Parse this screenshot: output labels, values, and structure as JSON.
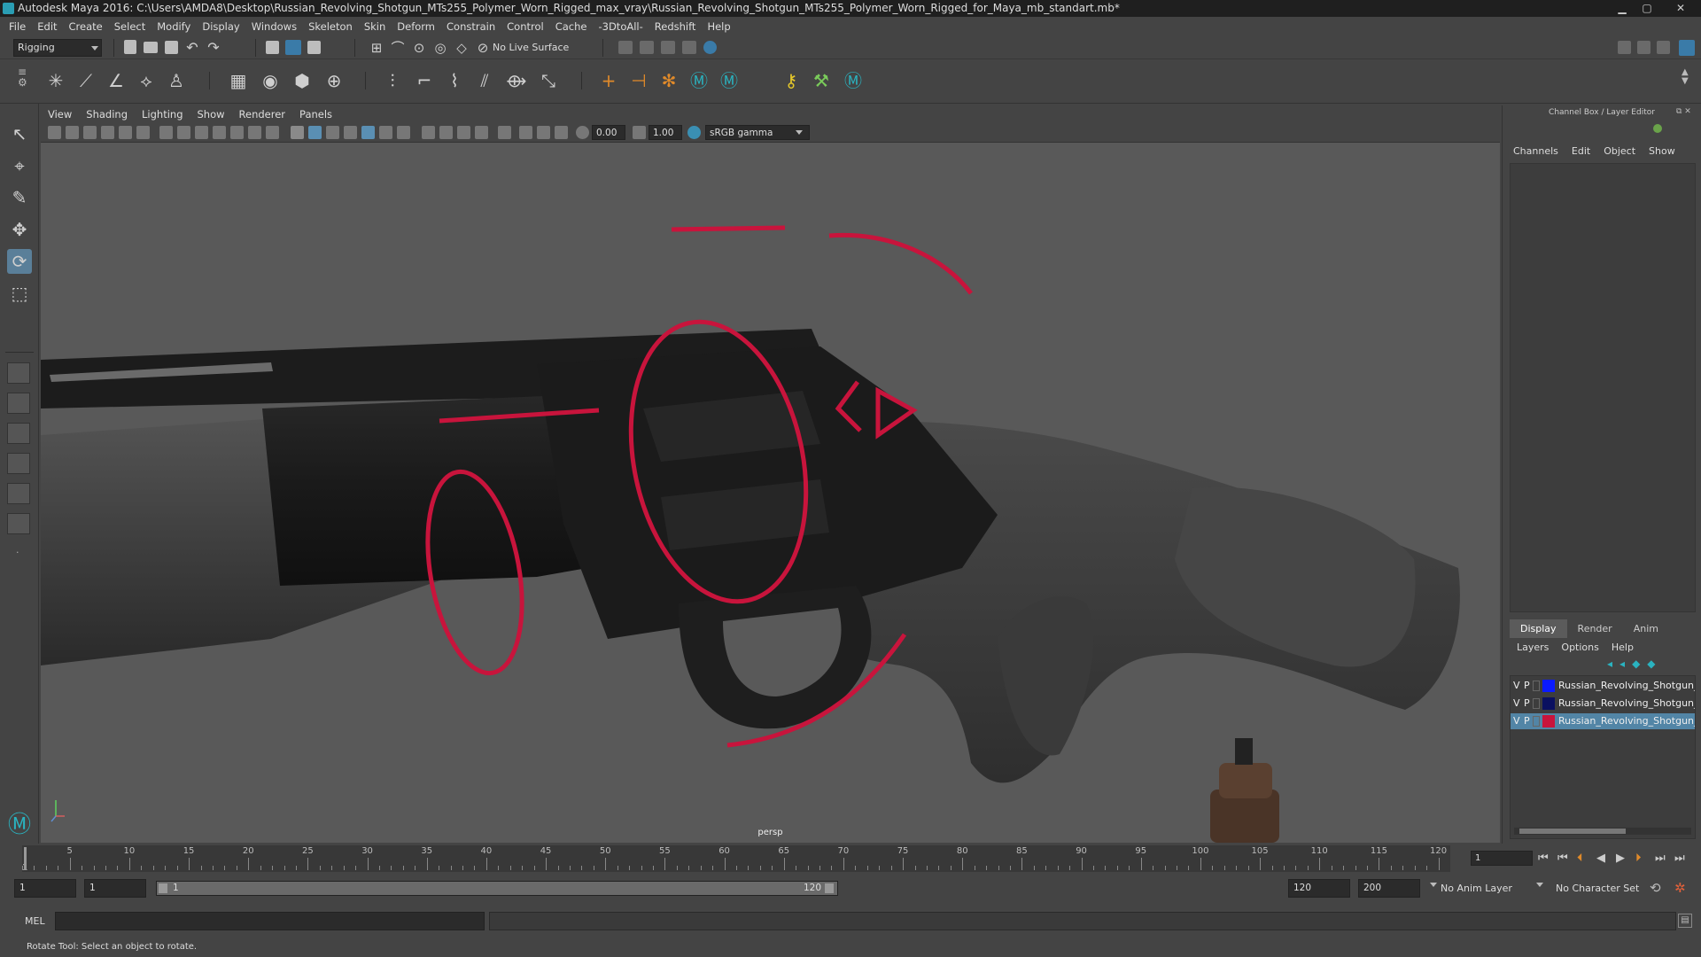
{
  "window": {
    "title": "Autodesk Maya 2016: C:\\Users\\AMDA8\\Desktop\\Russian_Revolving_Shotgun_MTs255_Polymer_Worn_Rigged_max_vray\\Russian_Revolving_Shotgun_MTs255_Polymer_Worn_Rigged_for_Maya_mb_standart.mb*",
    "minimize": "▁",
    "maximize": "▢",
    "close": "✕"
  },
  "menu": [
    "File",
    "Edit",
    "Create",
    "Select",
    "Modify",
    "Display",
    "Windows",
    "Skeleton",
    "Skin",
    "Deform",
    "Constrain",
    "Control",
    "Cache",
    "-3DtoAll-",
    "Redshift",
    "Help"
  ],
  "shelf": {
    "menuset": "Rigging",
    "live_surface": "No Live Surface"
  },
  "viewport_menu": [
    "View",
    "Shading",
    "Lighting",
    "Show",
    "Renderer",
    "Panels"
  ],
  "viewport_toolbar": {
    "exposure": "0.00",
    "gamma": "1.00",
    "color_space": "sRGB gamma"
  },
  "viewport": {
    "camera_label": "persp",
    "colors": {
      "background": "#595959",
      "controls": "#c8143c"
    }
  },
  "channel_box": {
    "title": "Channel Box / Layer Editor",
    "menu": [
      "Channels",
      "Edit",
      "Object",
      "Show"
    ]
  },
  "layer_editor": {
    "tabs": [
      "Display",
      "Render",
      "Anim"
    ],
    "active_tab": "Display",
    "menu": [
      "Layers",
      "Options",
      "Help"
    ],
    "layers": [
      {
        "v": "V",
        "p": "P",
        "name": "Russian_Revolving_Shotgun_",
        "color": "#0a1aff"
      },
      {
        "v": "V",
        "p": "P",
        "name": "Russian_Revolving_Shotgun_",
        "color": "#0a1060"
      },
      {
        "v": "V",
        "p": "P",
        "name": "Russian_Revolving_Shotgun_",
        "color": "#c8143c"
      }
    ]
  },
  "timeline": {
    "ticks": [
      "5",
      "10",
      "15",
      "20",
      "25",
      "30",
      "35",
      "40",
      "45",
      "50",
      "55",
      "60",
      "65",
      "70",
      "75",
      "80",
      "85",
      "90",
      "95",
      "100",
      "105",
      "110",
      "115",
      "120"
    ],
    "start_marker": "1",
    "current_frame": "1"
  },
  "range": {
    "start_time": "1",
    "playback_start": "1",
    "slider_start": "1",
    "slider_end": "120",
    "playback_end": "120",
    "end_time": "200",
    "anim_layer": "No Anim Layer",
    "character_set": "No Character Set"
  },
  "command_line": {
    "language": "MEL"
  },
  "status": {
    "help_line": "Rotate Tool: Select an object to rotate."
  }
}
